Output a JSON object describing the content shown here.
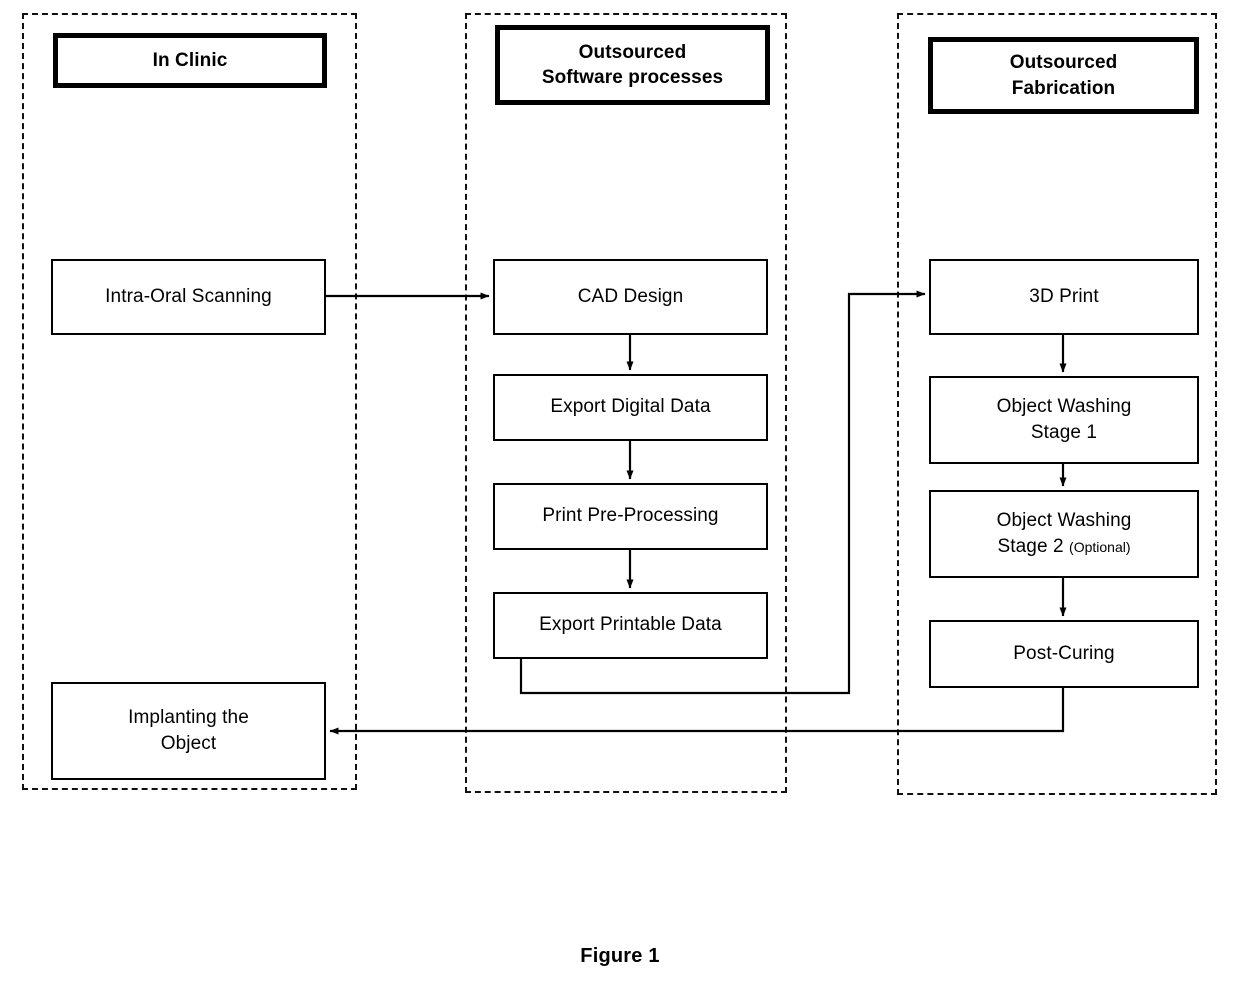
{
  "figure": {
    "caption": "Figure 1",
    "type": "flowchart"
  },
  "lanes": [
    {
      "id": "in-clinic",
      "header_line_1": "In Clinic",
      "header_line_2": ""
    },
    {
      "id": "outsourced-software",
      "header_line_1": "Outsourced",
      "header_line_2": "Software processes"
    },
    {
      "id": "outsourced-fabrication",
      "header_line_1": "Outsourced",
      "header_line_2": "Fabrication"
    }
  ],
  "nodes": {
    "intra_oral_scanning": {
      "line1": "Intra-Oral Scanning",
      "line2": ""
    },
    "implanting_the_object": {
      "line1": "Implanting the",
      "line2": "Object"
    },
    "cad_design": {
      "line1": "CAD Design",
      "line2": ""
    },
    "export_digital_data": {
      "line1": "Export Digital Data",
      "line2": ""
    },
    "print_pre_processing": {
      "line1": "Print Pre-Processing",
      "line2": ""
    },
    "export_printable_data": {
      "line1": "Export Printable Data",
      "line2": ""
    },
    "three_d_print": {
      "line1": "3D Print",
      "line2": ""
    },
    "object_washing_stage_1": {
      "line1": "Object Washing",
      "line2": "Stage 1"
    },
    "object_washing_stage_2": {
      "line1": "Object Washing",
      "line2": "Stage 2 ",
      "line2_note": "(Optional)"
    },
    "post_curing": {
      "line1": "Post-Curing",
      "line2": ""
    }
  },
  "colors": {
    "stroke": "#000000",
    "lane_border": "#111111",
    "background": "#ffffff"
  }
}
